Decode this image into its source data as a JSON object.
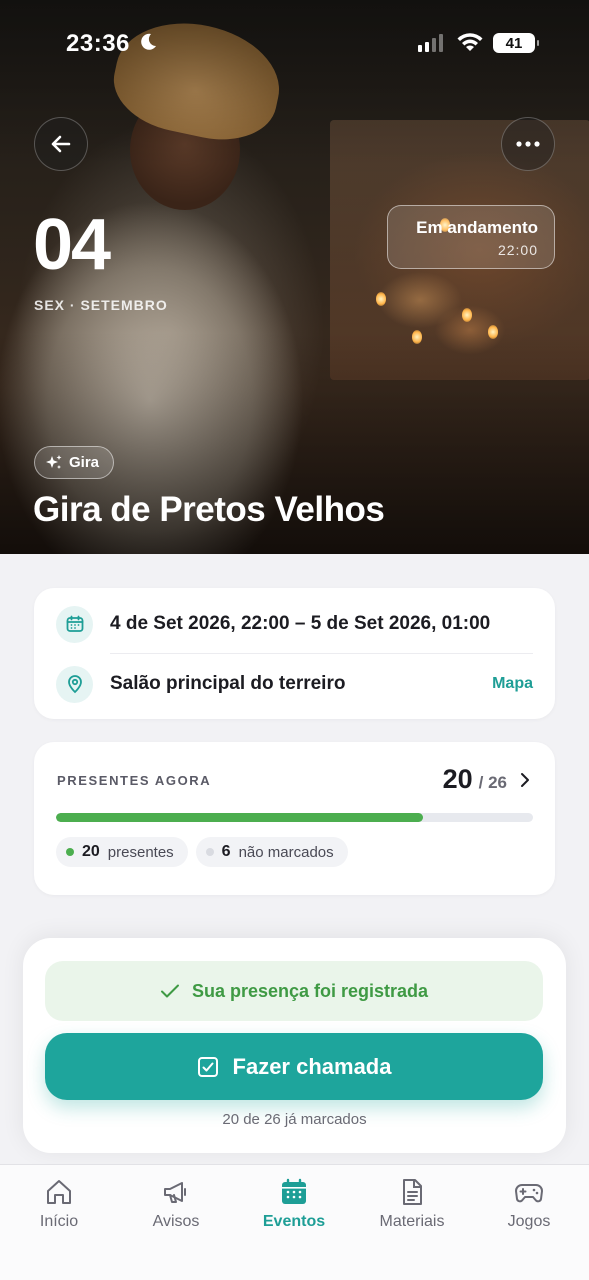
{
  "status_bar": {
    "time": "23:36",
    "battery": "41"
  },
  "hero": {
    "day": "04",
    "weekday_month": "SEX · SETEMBRO",
    "status_title": "Em andamento",
    "status_time": "22:00",
    "tag": "Gira",
    "title": "Gira de Pretos Velhos"
  },
  "info": {
    "datetime": "4 de Set 2026, 22:00 – 5 de Set 2026, 01:00",
    "location": "Salão principal do terreiro",
    "map_link": "Mapa"
  },
  "attendance": {
    "label": "PRESENTES AGORA",
    "present": "20",
    "total": "/ 26",
    "fraction": 0.769,
    "present_chip_count": "20",
    "present_chip_label": "presentes",
    "unmarked_chip_count": "6",
    "unmarked_chip_label": "não marcados"
  },
  "sheet": {
    "registered_text": "Sua presença foi registrada",
    "call_button": "Fazer chamada",
    "footer": "20 de 26 já marcados"
  },
  "tabs": [
    {
      "label": "Início",
      "icon": "home-icon"
    },
    {
      "label": "Avisos",
      "icon": "megaphone-icon"
    },
    {
      "label": "Eventos",
      "icon": "calendar-icon",
      "active": true
    },
    {
      "label": "Materiais",
      "icon": "document-icon"
    },
    {
      "label": "Jogos",
      "icon": "gamepad-icon"
    }
  ],
  "colors": {
    "accent": "#1ea59c",
    "success": "#4cae4f",
    "unmarked_dot": "#d9dbe1"
  }
}
